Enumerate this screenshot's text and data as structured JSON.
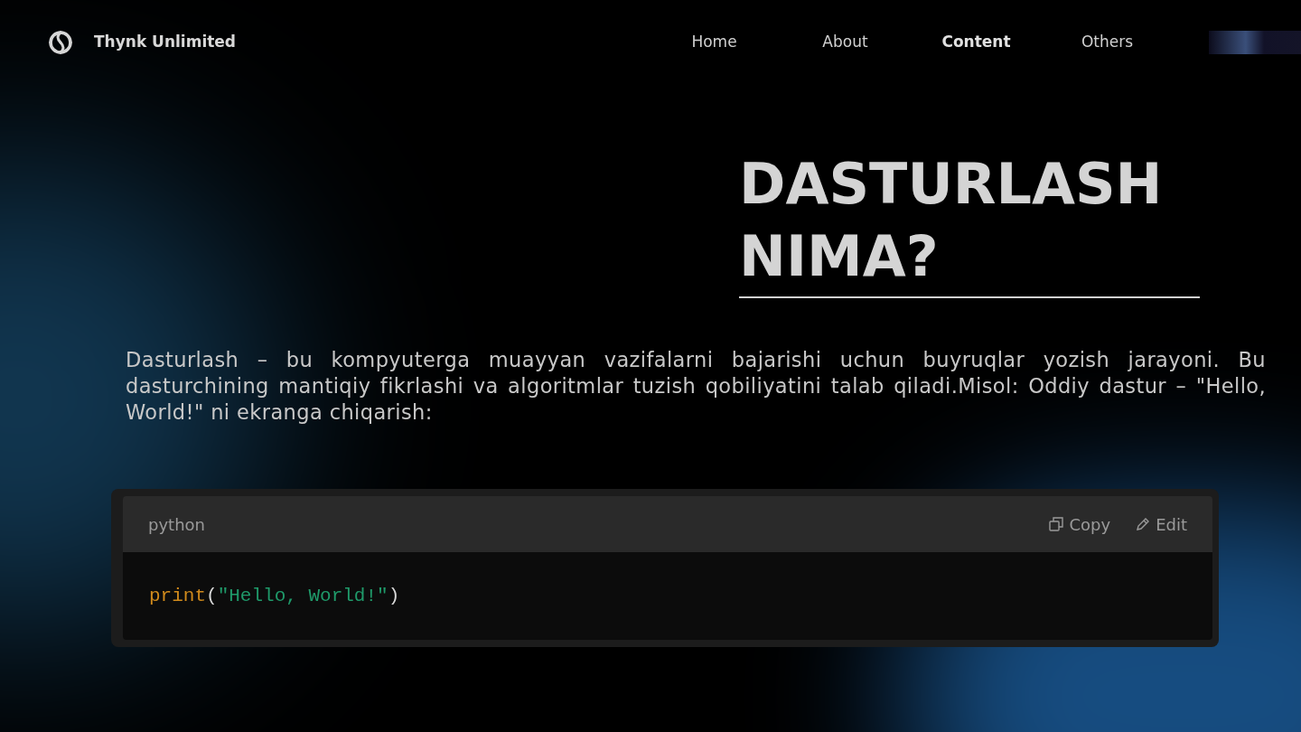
{
  "brand": {
    "name": "Thynk Unlimited"
  },
  "nav": [
    {
      "label": "Home",
      "selected": false
    },
    {
      "label": "About",
      "selected": false
    },
    {
      "label": "Content",
      "selected": true
    },
    {
      "label": "Others",
      "selected": false
    }
  ],
  "title": "DASTURLASH NIMA?",
  "paragraph": "Dasturlash – bu kompyuterga muayyan vazifalarni bajarishi uchun buyruqlar yozish jarayoni. Bu dasturchining mantiqiy fikrlashi va algoritmlar tuzish qobiliyatini talab qiladi.Misol: Oddiy dastur – \"Hello, World!\" ni ekranga chiqarish:",
  "code_block": {
    "language": "python",
    "actions": [
      {
        "kind": "copy",
        "label": "Copy"
      },
      {
        "kind": "edit",
        "label": "Edit"
      }
    ],
    "tokens": [
      {
        "kind": "function",
        "text": "print"
      },
      {
        "kind": "punct",
        "text": "("
      },
      {
        "kind": "string",
        "text": "\"Hello, World!\""
      },
      {
        "kind": "punct",
        "text": ")"
      }
    ]
  }
}
